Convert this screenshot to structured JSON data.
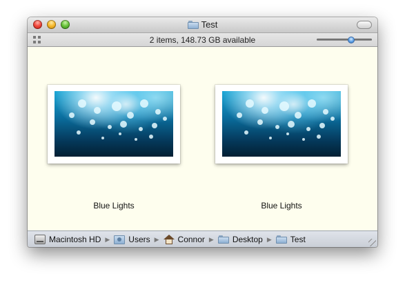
{
  "window": {
    "title": "Test",
    "title_icon": "folder-icon"
  },
  "status": {
    "text": "2 items, 148.73 GB available",
    "icon_size_slider_value": 0.62
  },
  "items": [
    {
      "label": "Blue Lights",
      "icon": "image-thumbnail"
    },
    {
      "label": "Blue Lights",
      "icon": "image-thumbnail"
    }
  ],
  "pathbar": {
    "crumbs": [
      {
        "label": "Macintosh HD",
        "icon": "hard-drive-icon"
      },
      {
        "label": "Users",
        "icon": "users-folder-icon"
      },
      {
        "label": "Connor",
        "icon": "home-icon"
      },
      {
        "label": "Desktop",
        "icon": "folder-icon"
      },
      {
        "label": "Test",
        "icon": "folder-icon"
      }
    ]
  },
  "colors": {
    "content_background": "#fefeee",
    "selection_accent": "#5da0e6"
  }
}
